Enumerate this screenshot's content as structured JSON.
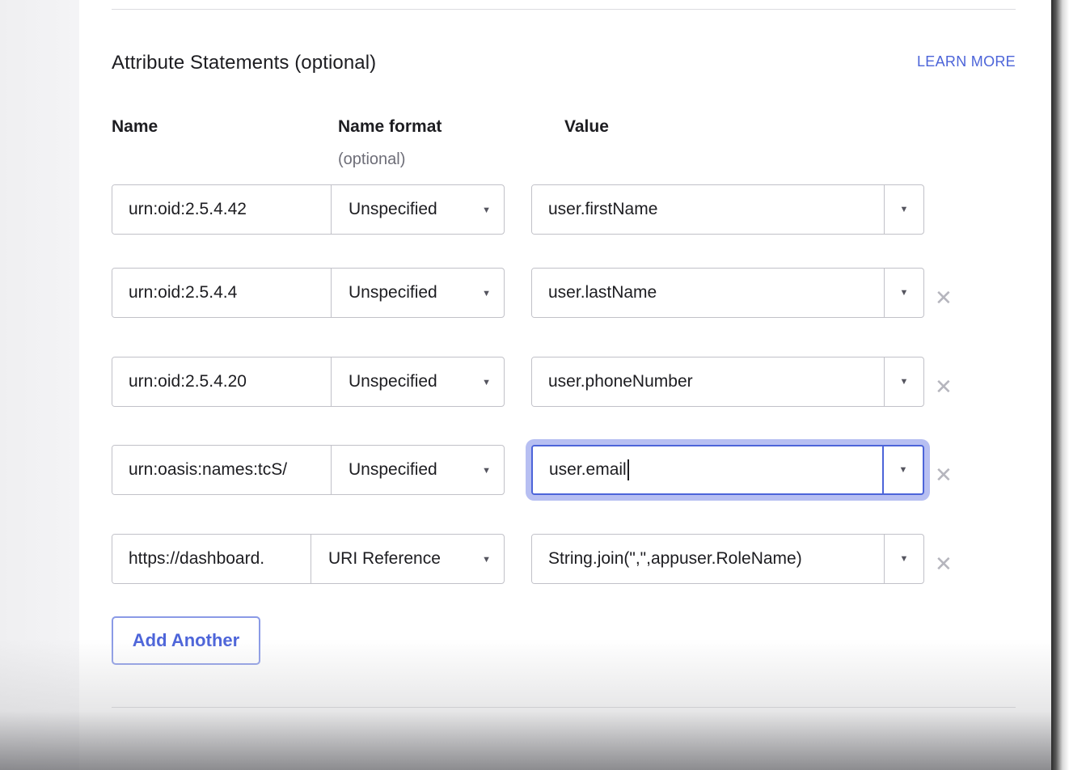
{
  "section": {
    "title": "Attribute Statements (optional)",
    "learn_more": "LEARN MORE"
  },
  "columns": {
    "name": "Name",
    "name_format": "Name format",
    "name_format_sub": "(optional)",
    "value": "Value"
  },
  "rows": [
    {
      "name": "urn:oid:2.5.4.42",
      "format": "Unspecified",
      "value": "user.firstName",
      "removable": false,
      "focused": false
    },
    {
      "name": "urn:oid:2.5.4.4",
      "format": "Unspecified",
      "value": "user.lastName",
      "removable": true,
      "focused": false
    },
    {
      "name": "urn:oid:2.5.4.20",
      "format": "Unspecified",
      "value": "user.phoneNumber",
      "removable": true,
      "focused": false
    },
    {
      "name": "urn:oasis:names:tcS/",
      "format": "Unspecified",
      "value": "user.email",
      "removable": true,
      "focused": true
    },
    {
      "name": "https://dashboard.",
      "format": "URI Reference",
      "value": "String.join(\",\",appuser.RoleName)",
      "removable": true,
      "focused": false
    }
  ],
  "icons": {
    "caret": "▼",
    "remove": "✕"
  },
  "add_button": "Add Another",
  "colors": {
    "accent": "#4c64d9",
    "focus_ring": "#7c8be8",
    "border": "#c1c1c8"
  }
}
